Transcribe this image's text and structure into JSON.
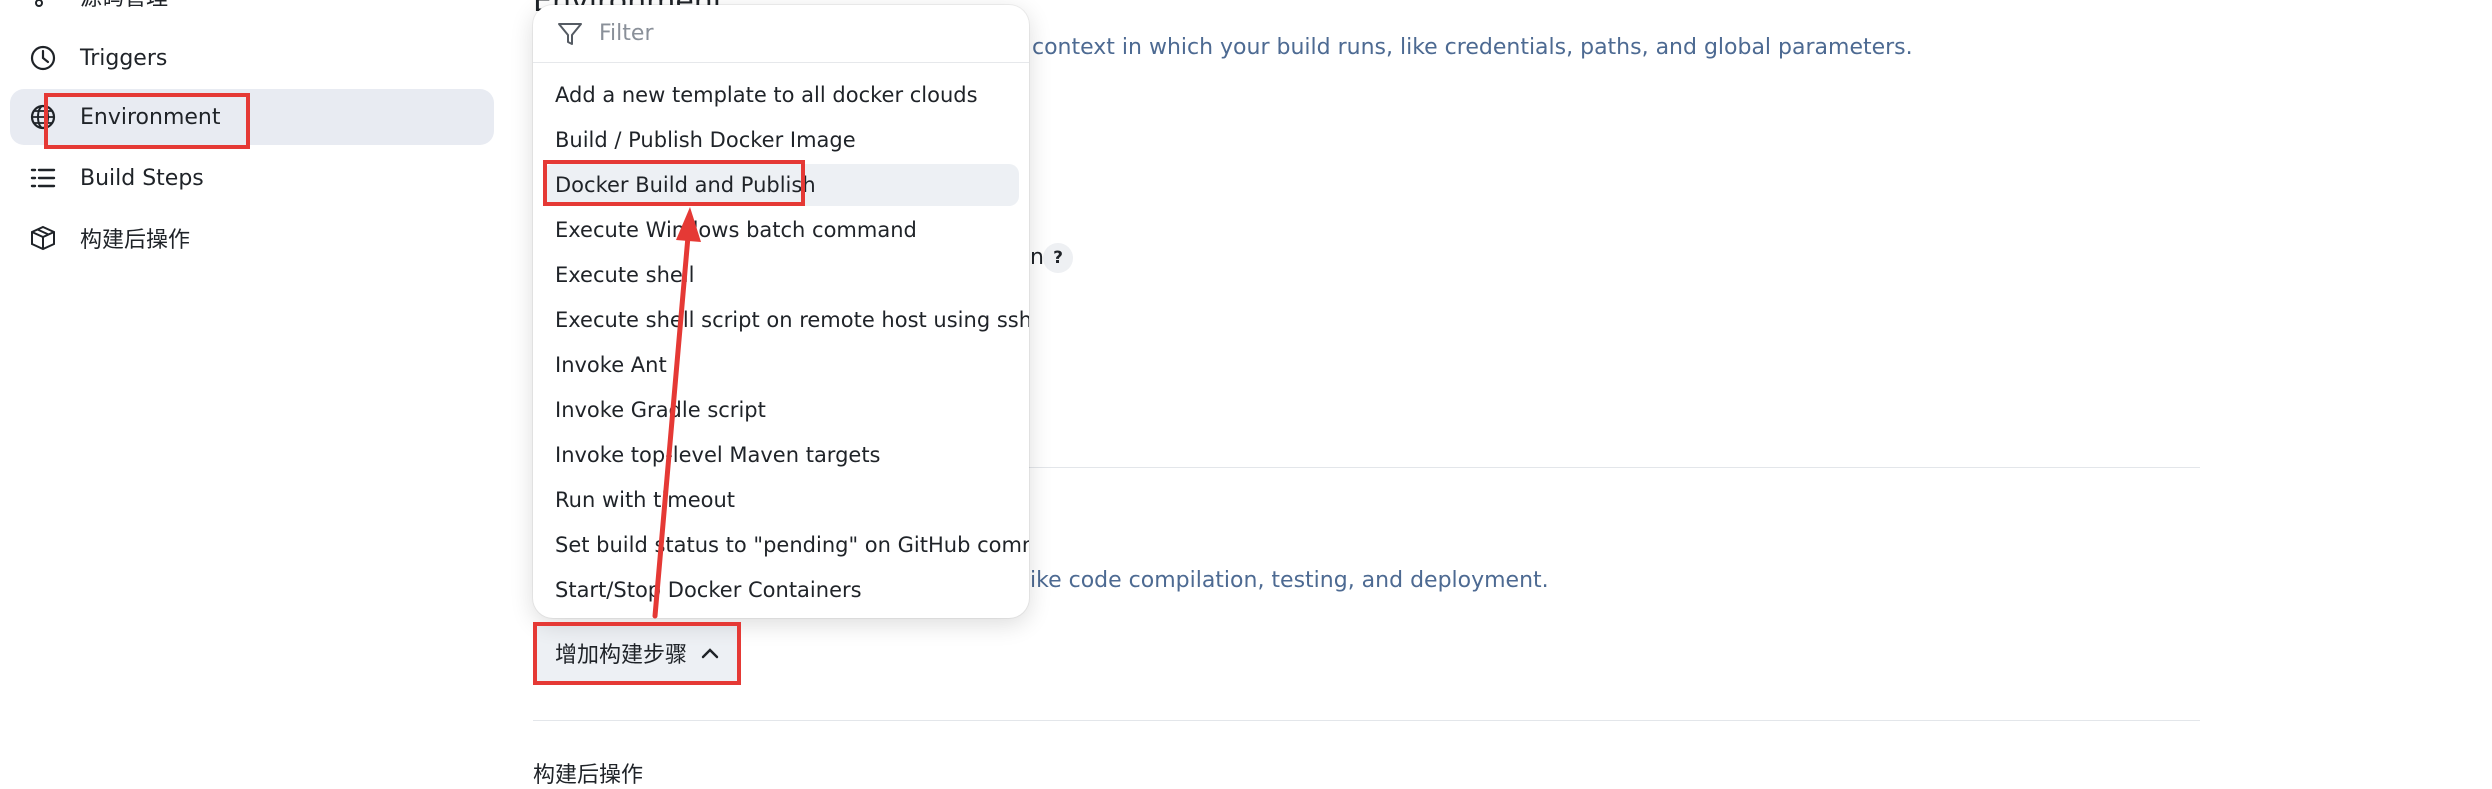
{
  "sidebar": {
    "items": [
      {
        "label": "源码管理",
        "icon": "git-branch-icon"
      },
      {
        "label": "Triggers",
        "icon": "clock-icon"
      },
      {
        "label": "Environment",
        "icon": "globe-icon",
        "active": true
      },
      {
        "label": "Build Steps",
        "icon": "list-icon"
      },
      {
        "label": "构建后操作",
        "icon": "box-icon"
      }
    ]
  },
  "main": {
    "section_title_cut": "Environment",
    "environment_desc_visible": "context in which your build runs, like credentials, paths, and global parameters.",
    "partial_char": "n",
    "help_label": "?",
    "build_steps_desc_visible": "ike code compilation, testing, and deployment.",
    "post_build_title_cut": "构建后操作"
  },
  "dropdown": {
    "filter_placeholder": "Filter",
    "items": [
      "Add a new template to all docker clouds",
      "Build / Publish Docker Image",
      "Docker Build and Publish",
      "Execute Windows batch command",
      "Execute shell",
      "Execute shell script on remote host using ssh",
      "Invoke Ant",
      "Invoke Gradle script",
      "Invoke top-level Maven targets",
      "Run with timeout",
      "Set build status to \"pending\" on GitHub commit",
      "Start/Stop Docker Containers"
    ]
  },
  "add_step_button": {
    "label": "增加构建步骤",
    "icon": "chevron-up-icon"
  },
  "colors": {
    "annotation_red": "#e53935",
    "active_bg": "#e8ebf2",
    "link_blue": "#4d6a92"
  }
}
